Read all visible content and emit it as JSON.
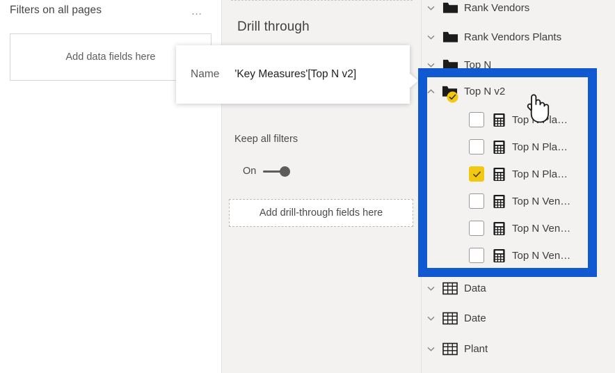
{
  "filters_pane": {
    "title": "Filters on all pages",
    "ellipsis": "…",
    "drop_zone_label": "Add data fields here"
  },
  "drill_pane": {
    "title": "Drill through",
    "keep_all_filters_label": "Keep all filters",
    "toggle_state": "On",
    "drop_zone_label": "Add drill-through fields here"
  },
  "tooltip": {
    "key": "Name",
    "value": "'Key Measures'[Top N v2]"
  },
  "fields_pane": {
    "rows": [
      {
        "label": "Rank Vendors",
        "icon": "folder-icon",
        "chevron": "chevron-down-icon",
        "expanded": false,
        "badge": false
      },
      {
        "label": "Rank Vendors Plants",
        "icon": "folder-icon",
        "chevron": "chevron-down-icon",
        "expanded": false,
        "badge": false
      },
      {
        "label": "Top N",
        "icon": "folder-icon",
        "chevron": "chevron-down-icon",
        "expanded": false,
        "badge": false
      },
      {
        "label": "Top N v2",
        "icon": "folder-icon",
        "chevron": "chevron-up-icon",
        "expanded": true,
        "badge": true
      }
    ],
    "measures": [
      {
        "label": "Top N Pla…",
        "icon": "measure-icon",
        "checked": false
      },
      {
        "label": "Top N Pla…",
        "icon": "measure-icon",
        "checked": false
      },
      {
        "label": "Top N Pla…",
        "icon": "measure-icon",
        "checked": true
      },
      {
        "label": "Top N Ven…",
        "icon": "measure-icon",
        "checked": false
      },
      {
        "label": "Top N Ven…",
        "icon": "measure-icon",
        "checked": false
      },
      {
        "label": "Top N Ven…",
        "icon": "measure-icon",
        "checked": false
      }
    ],
    "tables": [
      {
        "label": "Data",
        "icon": "table-icon",
        "chevron": "chevron-down-icon"
      },
      {
        "label": "Date",
        "icon": "table-icon",
        "chevron": "chevron-down-icon"
      },
      {
        "label": "Plant",
        "icon": "table-icon",
        "chevron": "chevron-down-icon"
      }
    ]
  },
  "annotation": {
    "highlight_color": "#1059d0"
  },
  "cursor": {
    "type": "pointing-hand-cursor"
  }
}
